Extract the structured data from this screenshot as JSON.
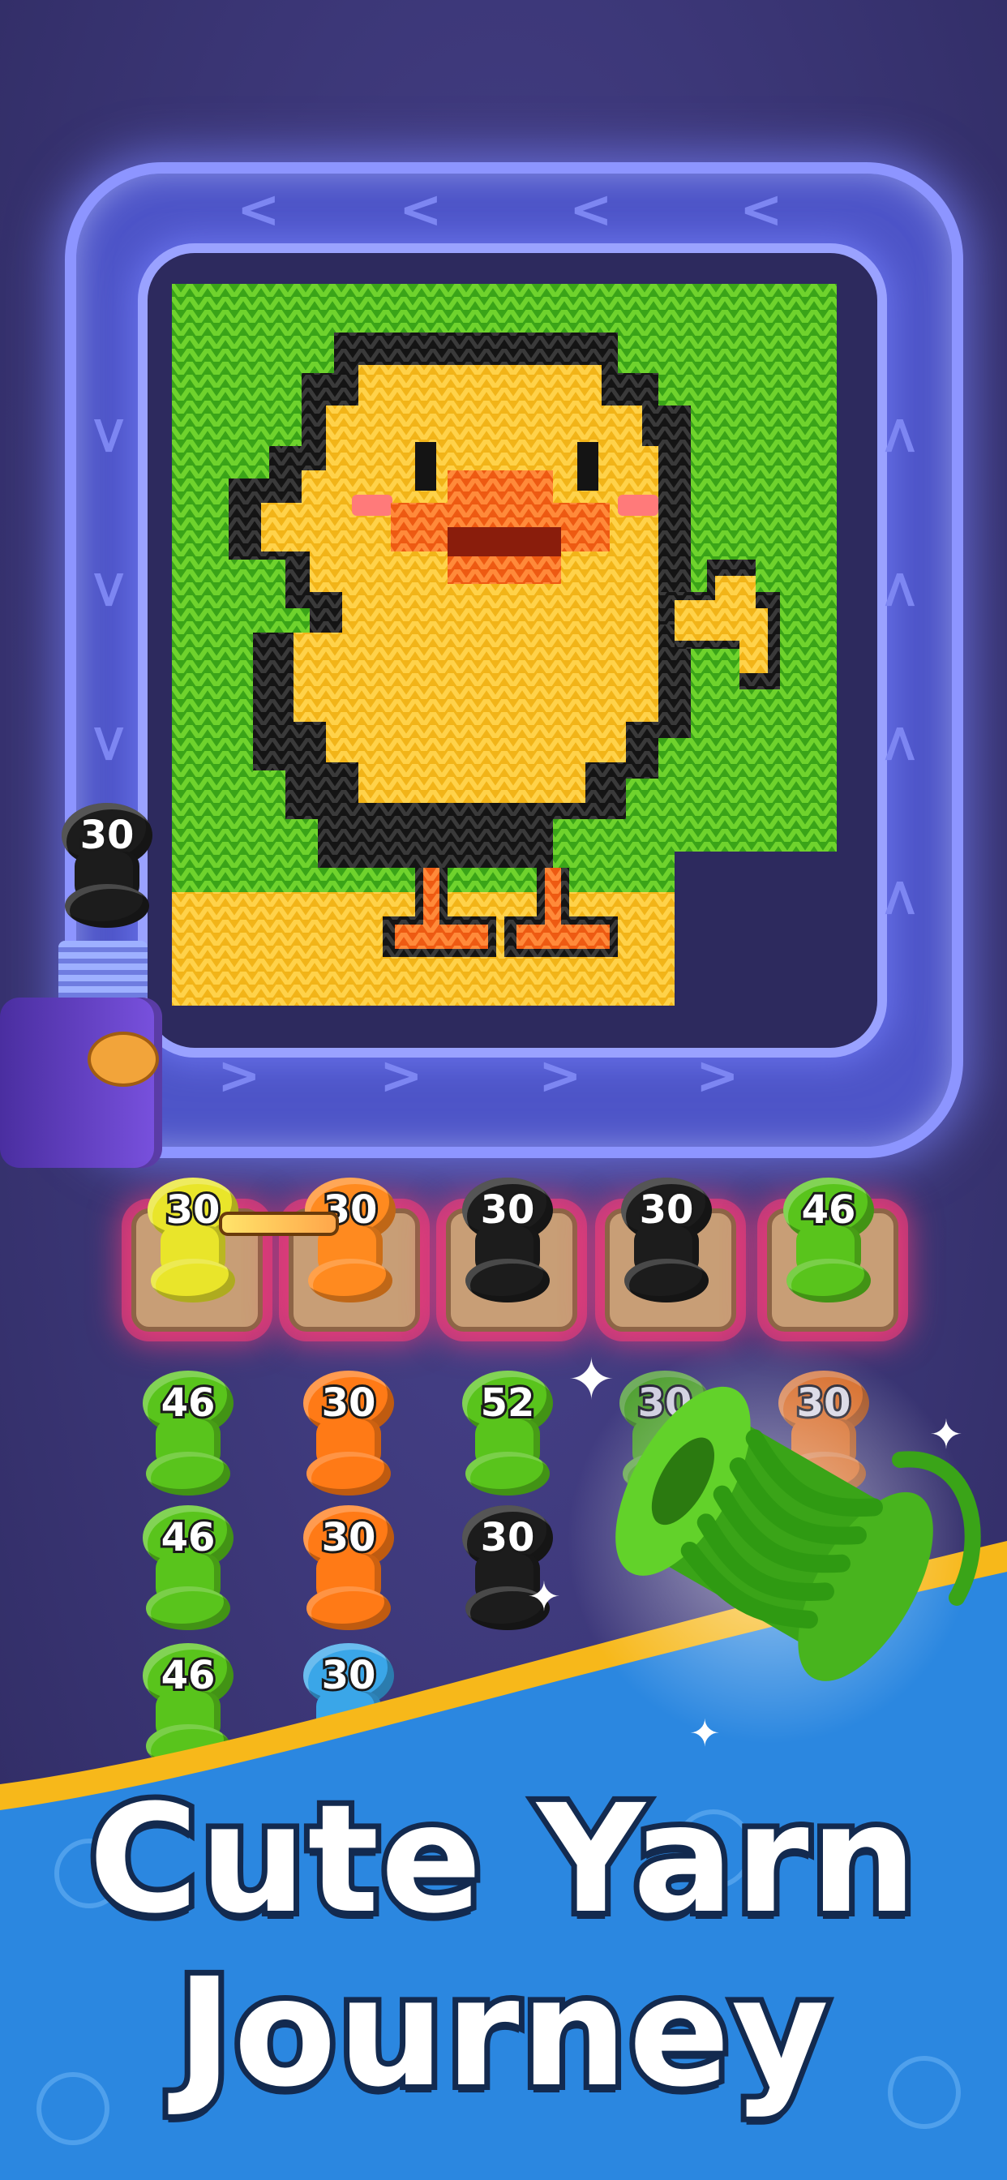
{
  "game": {
    "headline_line1": "Cute Yarn",
    "headline_line2": "Journey"
  },
  "queue_spool": {
    "count": "30",
    "color": "#1c1c1c"
  },
  "holders": [
    {
      "count": "30",
      "color": "#e9e52a"
    },
    {
      "count": "30",
      "color": "#ff8a1f"
    },
    {
      "count": "30",
      "color": "#1c1c1c"
    },
    {
      "count": "30",
      "color": "#1c1c1c"
    },
    {
      "count": "46",
      "color": "#59c41c"
    }
  ],
  "grid_columns": [
    {
      "spools": [
        {
          "count": "46",
          "color": "#59c41c"
        },
        {
          "count": "46",
          "color": "#59c41c"
        },
        {
          "count": "46",
          "color": "#59c41c"
        }
      ]
    },
    {
      "spools": [
        {
          "count": "30",
          "color": "#ff7a16"
        },
        {
          "count": "30",
          "color": "#ff7a16"
        },
        {
          "count": "30",
          "color": "#3aa6e8"
        }
      ]
    },
    {
      "spools": [
        {
          "count": "52",
          "color": "#59c41c"
        },
        {
          "count": "30",
          "color": "#1c1c1c"
        }
      ]
    },
    {
      "spools": [
        {
          "count": "30",
          "color": "#59c41c"
        }
      ]
    },
    {
      "spools": [
        {
          "count": "30",
          "color": "#ff7a16"
        }
      ]
    }
  ],
  "colors": {
    "background": "#3b3676",
    "track": "#4e55c8",
    "track_glow": "#8d95ff",
    "banner_blue": "#2b87e0",
    "banner_stripe": "#f7b81a",
    "highlight_pink": "#ff3c78",
    "feature_spool": "#52c61a"
  },
  "icons": [
    "chevron-left-icon",
    "chevron-right-icon",
    "chevron-up-icon",
    "chevron-down-icon",
    "sparkle-icon",
    "yarn-spool-icon",
    "yarn-ball-icon"
  ]
}
